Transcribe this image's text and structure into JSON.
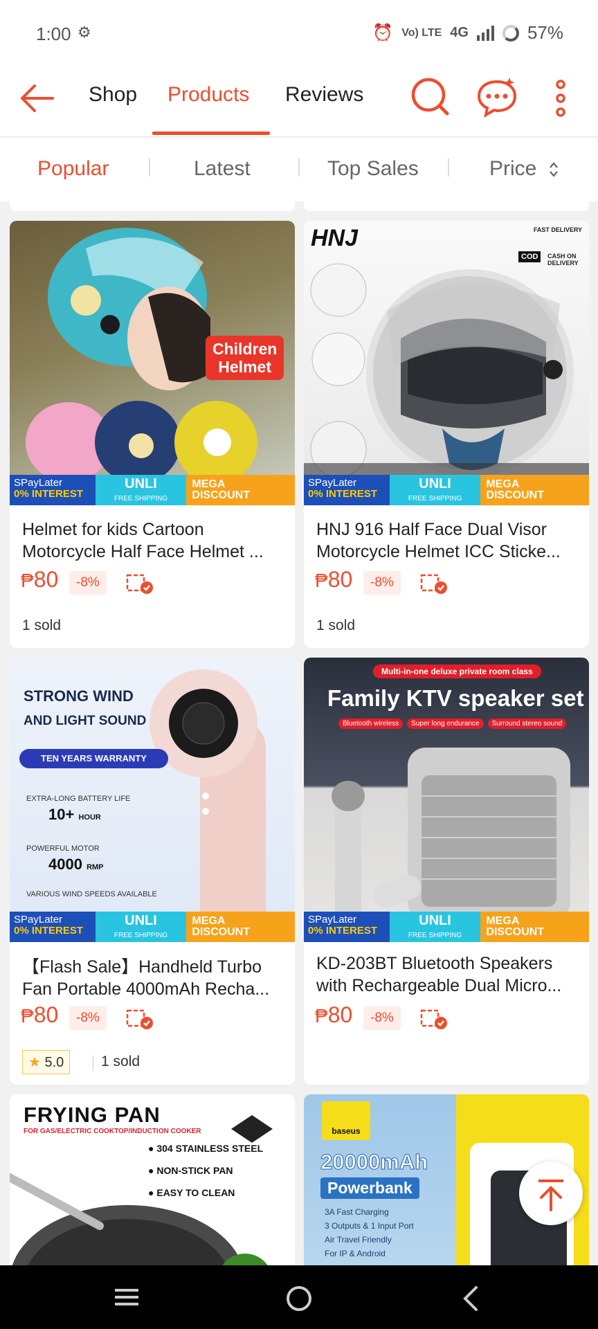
{
  "status": {
    "time": "1:00",
    "net_small": "Vo) LTE",
    "net_type": "4G",
    "battery": "57%"
  },
  "header": {
    "tabs": [
      {
        "label": "Shop",
        "active": false
      },
      {
        "label": "Products",
        "active": true
      },
      {
        "label": "Reviews",
        "active": false
      }
    ],
    "accent": "#ee4d2d"
  },
  "sort": {
    "options": [
      "Popular",
      "Latest",
      "Top Sales",
      "Price"
    ],
    "active": "Popular"
  },
  "promo": {
    "spaylater": "SPayLater",
    "interest": "0% INTEREST",
    "unli": "UNLI",
    "free_shipping": "FREE SHIPPING",
    "mega": "MEGA",
    "discount": "DISCOUNT"
  },
  "products": [
    {
      "title": "Helmet for kids Cartoon Motorcycle Half Face Helmet ...",
      "currency": "₱",
      "price": "80",
      "discount": "-8%",
      "sold": "1 sold",
      "image_text": [
        "Children",
        "Helmet"
      ]
    },
    {
      "title": "HNJ 916 Half Face Dual Visor Motorcycle Helmet ICC Sticke...",
      "currency": "₱",
      "price": "80",
      "discount": "-8%",
      "sold": "1 sold",
      "image_text": [
        "HNJ",
        "FAST DELIVERY",
        "COD",
        "CASH ON DELIVERY"
      ]
    },
    {
      "title": "【Flash Sale】Handheld Turbo Fan Portable 4000mAh Recha...",
      "currency": "₱",
      "price": "80",
      "discount": "-8%",
      "rating": "5.0",
      "sold": "1 sold",
      "image_text": [
        "STRONG WIND",
        "AND LIGHT SOUND",
        "TEN YEARS WARRANTY",
        "EXTRA-LONG BATTERY LIFE",
        "10+",
        "HOUR",
        "POWERFUL MOTOR",
        "4000",
        "RMP",
        "VARIOUS WIND SPEEDS AVAILABLE"
      ]
    },
    {
      "title": "KD-203BT Bluetooth Speakers with Rechargeable Dual Micro...",
      "currency": "₱",
      "price": "80",
      "discount": "-8%",
      "image_text": [
        "Multi-in-one deluxe private room class",
        "Family KTV speaker set",
        "Bluetooth wireless",
        "Super long endurance",
        "Surround stereo sound"
      ]
    },
    {
      "image_text": [
        "FRYING PAN",
        "FOR GAS/ELECTRIC COOKTOP/INDUCTION COOKER",
        "304 STAINLESS STEEL",
        "NON-STICK PAN",
        "EASY TO CLEAN"
      ]
    },
    {
      "image_text": [
        "baseus",
        "20000mAh",
        "Powerbank",
        "3A Fast Charging",
        "3 Outputs & 1 Input Port",
        "Air Travel Friendly",
        "For IP & Android"
      ]
    }
  ]
}
